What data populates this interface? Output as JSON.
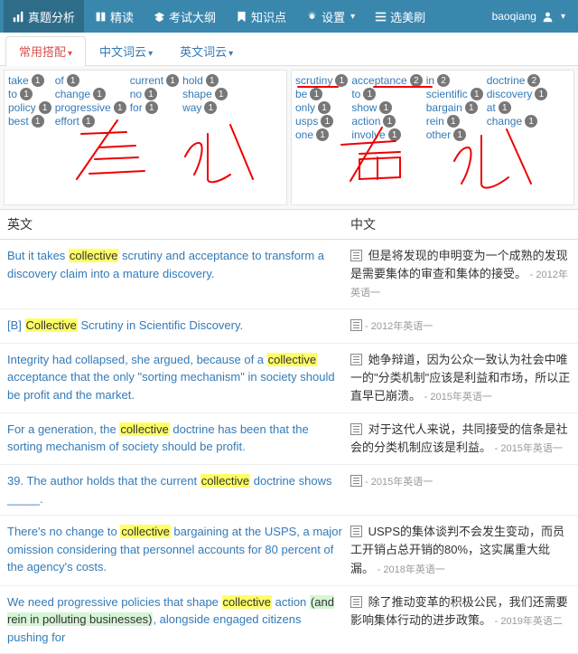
{
  "topnav": {
    "items": [
      {
        "label": "真题分析"
      },
      {
        "label": "精读"
      },
      {
        "label": "考试大纲"
      },
      {
        "label": "知识点"
      },
      {
        "label": "设置"
      },
      {
        "label": "选美刷"
      }
    ],
    "user": "baoqiang"
  },
  "subtabs": [
    {
      "label": "常用搭配"
    },
    {
      "label": "中文词云"
    },
    {
      "label": "英文词云"
    }
  ],
  "leftpane": {
    "cols": [
      [
        {
          "w": "take",
          "n": 1
        },
        {
          "w": "to",
          "n": 1
        },
        {
          "w": "policy",
          "n": 1
        },
        {
          "w": "best",
          "n": 1
        }
      ],
      [
        {
          "w": "of",
          "n": 1
        },
        {
          "w": "change",
          "n": 1
        },
        {
          "w": "progressive",
          "n": 1
        },
        {
          "w": "effort",
          "n": 1
        }
      ],
      [
        {
          "w": "current",
          "n": 1
        },
        {
          "w": "no",
          "n": 1
        },
        {
          "w": "for",
          "n": 1
        }
      ],
      [
        {
          "w": "hold",
          "n": 1
        },
        {
          "w": "shape",
          "n": 1
        },
        {
          "w": "way",
          "n": 1
        }
      ]
    ],
    "hand": "左 边"
  },
  "rightpane": {
    "cols": [
      [
        {
          "w": "scrutiny",
          "n": 1
        },
        {
          "w": "be",
          "n": 1
        },
        {
          "w": "only",
          "n": 1
        },
        {
          "w": "usps",
          "n": 1
        },
        {
          "w": "one",
          "n": 1
        }
      ],
      [
        {
          "w": "acceptance",
          "n": 2
        },
        {
          "w": "to",
          "n": 1
        },
        {
          "w": "show",
          "n": 1
        },
        {
          "w": "action",
          "n": 1
        },
        {
          "w": "involve",
          "n": 1
        }
      ],
      [
        {
          "w": "in",
          "n": 2
        },
        {
          "w": "scientific",
          "n": 1
        },
        {
          "w": "bargain",
          "n": 1
        },
        {
          "w": "rein",
          "n": 1
        },
        {
          "w": "other",
          "n": 1
        }
      ],
      [
        {
          "w": "doctrine",
          "n": 2
        },
        {
          "w": "discovery",
          "n": 1
        },
        {
          "w": "at",
          "n": 1
        },
        {
          "w": "change",
          "n": 1
        }
      ]
    ],
    "hand": "右 边"
  },
  "headers": {
    "en": "英文",
    "cn": "中文"
  },
  "sentences": [
    {
      "en": [
        "But it takes ",
        [
          "hl",
          "collective"
        ],
        " scrutiny and acceptance to transform a discovery claim into a mature discovery."
      ],
      "cn": "但是将发现的申明变为一个成熟的发现是需要集体的审查和集体的接受。",
      "src": "- 2012年英语一"
    },
    {
      "en": [
        "[B] ",
        [
          "hl",
          "Collective"
        ],
        " Scrutiny in Scientific Discovery."
      ],
      "cn": "",
      "src": "- 2012年英语一"
    },
    {
      "en": [
        "Integrity had collapsed, she argued, because of a ",
        [
          "hl",
          "collective"
        ],
        " acceptance that the only \"sorting mechanism\" in society should be profit and the market."
      ],
      "cn": "她争辩道，因为公众一致认为社会中唯一的\"分类机制\"应该是利益和市场，所以正直早已崩溃。",
      "src": "- 2015年英语一"
    },
    {
      "en": [
        "For a generation, the ",
        [
          "hl",
          "collective"
        ],
        " doctrine has been that the sorting mechanism of society should be profit."
      ],
      "cn": "对于这代人来说，共同接受的信条是社会的分类机制应该是利益。",
      "src": "- 2015年英语一"
    },
    {
      "en": [
        "39. The author holds that the current ",
        [
          "hl",
          "collective"
        ],
        " doctrine shows _____."
      ],
      "cn": "",
      "src": "- 2015年英语一"
    },
    {
      "en": [
        "There's no change to ",
        [
          "hl",
          "collective"
        ],
        " bargaining at the USPS, a major omission considering that personnel accounts for 80 percent of the agency's costs."
      ],
      "cn": "USPS的集体谈判不会发生变动，而员工开销占总开销的80%，这实属重大纰漏。",
      "src": "- 2018年英语一"
    },
    {
      "en": [
        "We need progressive policies that shape ",
        [
          "hl",
          "collective"
        ],
        " action ",
        [
          "hlg",
          "(and rein in polluting businesses)"
        ],
        ", alongside engaged citizens pushing for"
      ],
      "cn": "除了推动变革的积极公民，我们还需要影响集体行动的进步政策。",
      "src": "- 2019年英语二"
    }
  ]
}
